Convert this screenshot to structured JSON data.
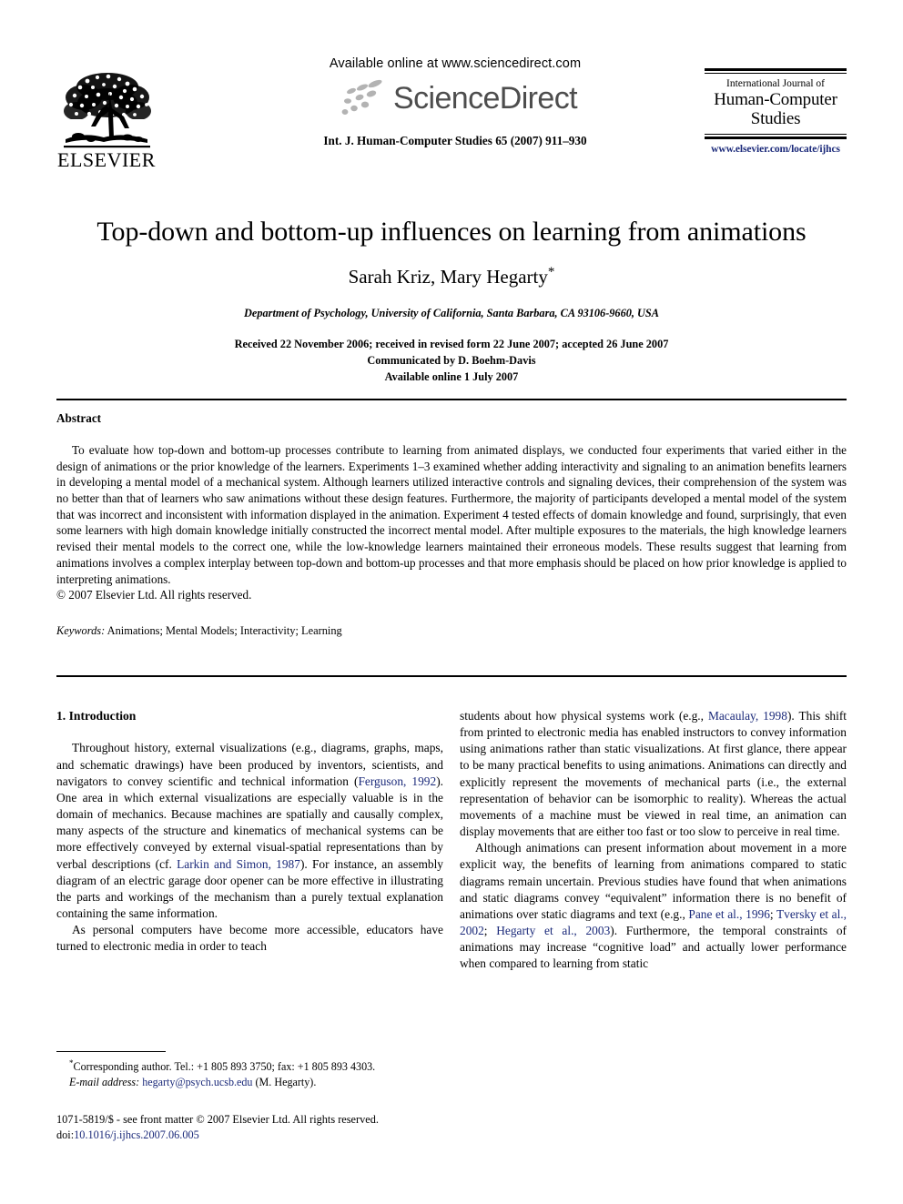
{
  "masthead": {
    "publisher_logo_label": "ELSEVIER",
    "sciencedirect": {
      "available_online": "Available online at www.sciencedirect.com",
      "wordmark": "ScienceDirect",
      "journal_reference": "Int. J. Human-Computer Studies 65 (2007) 911–930"
    },
    "journal_box": {
      "line1": "International Journal of",
      "line2": "Human-Computer",
      "line3": "Studies",
      "url": "www.elsevier.com/locate/ijhcs",
      "url_color": "#1b2a7a"
    }
  },
  "title_block": {
    "title": "Top-down and bottom-up influences on learning from animations",
    "authors": "Sarah Kriz, Mary Hegarty",
    "corresponding_marker": "*",
    "affiliation": "Department of Psychology, University of California, Santa Barbara, CA 93106-9660, USA",
    "history_line1": "Received 22 November 2006; received in revised form 22 June 2007; accepted 26 June 2007",
    "history_line2": "Communicated by D. Boehm-Davis",
    "history_line3": "Available online 1 July 2007"
  },
  "abstract": {
    "heading": "Abstract",
    "body": "To evaluate how top-down and bottom-up processes contribute to learning from animated displays, we conducted four experiments that varied either in the design of animations or the prior knowledge of the learners. Experiments 1–3 examined whether adding interactivity and signaling to an animation benefits learners in developing a mental model of a mechanical system. Although learners utilized interactive controls and signaling devices, their comprehension of the system was no better than that of learners who saw animations without these design features. Furthermore, the majority of participants developed a mental model of the system that was incorrect and inconsistent with information displayed in the animation. Experiment 4 tested effects of domain knowledge and found, surprisingly, that even some learners with high domain knowledge initially constructed the incorrect mental model. After multiple exposures to the materials, the high knowledge learners revised their mental models to the correct one, while the low-knowledge learners maintained their erroneous models. These results suggest that learning from animations involves a complex interplay between top-down and bottom-up processes and that more emphasis should be placed on how prior knowledge is applied to interpreting animations.",
    "copyright": "© 2007 Elsevier Ltd. All rights reserved.",
    "keywords_label": "Keywords:",
    "keywords_value": "Animations; Mental Models; Interactivity; Learning"
  },
  "body": {
    "section_heading": "1. Introduction",
    "left_col": {
      "p1_part1": "Throughout history, external visualizations (e.g., diagrams, graphs, maps, and schematic drawings) have been produced by inventors, scientists, and navigators to convey scientific and technical information (",
      "p1_cite1": "Ferguson, 1992",
      "p1_part2": "). One area in which external visualizations are especially valuable is in the domain of mechanics. Because machines are spatially and causally complex, many aspects of the structure and kinematics of mechanical systems can be more effectively conveyed by external visual-spatial representations than by verbal descriptions (cf. ",
      "p1_cite2": "Larkin and Simon, 1987",
      "p1_part3": "). For instance, an assembly diagram of an electric garage door opener can be more effective in illustrating the parts and workings of the mechanism than a purely textual explanation containing the same information.",
      "p2": "As personal computers have become more accessible, educators have turned to electronic media in order to teach"
    },
    "right_col": {
      "p2_cont_part1": "students about how physical systems work (e.g., ",
      "p2_cite1": "Macaulay, 1998",
      "p2_part2": "). This shift from printed to electronic media has enabled instructors to convey information using animations rather than static visualizations. At first glance, there appear to be many practical benefits to using animations. Animations can directly and explicitly represent the movements of mechanical parts (i.e., the external representation of behavior can be isomorphic to reality). Whereas the actual movements of a machine must be viewed in real time, an animation can display movements that are either too fast or too slow to perceive in real time.",
      "p3_part1": "Although animations can present information about movement in a more explicit way, the benefits of learning from animations compared to static diagrams remain uncertain. Previous studies have found that when animations and static diagrams convey “equivalent” information there is no benefit of animations over static diagrams and text (e.g., ",
      "p3_cite1": "Pane et al., 1996",
      "p3_sep1": "; ",
      "p3_cite2": "Tversky et al., 2002",
      "p3_sep2": "; ",
      "p3_cite3": "Hegarty et al., 2003",
      "p3_part2": "). Furthermore, the temporal constraints of animations may increase “cognitive load” and actually lower performance when compared to learning from static"
    }
  },
  "footnote": {
    "corresponding_marker": "*",
    "corresponding_text": "Corresponding author. Tel.: +1 805 893 3750; fax: +1 805 893 4303.",
    "email_label": "E-mail address:",
    "email_address": "hegarty@psych.ucsb.edu",
    "email_owner": "(M. Hegarty)."
  },
  "imprint": {
    "front_matter": "1071-5819/$ - see front matter © 2007 Elsevier Ltd. All rights reserved.",
    "doi_label": "doi:",
    "doi_value": "10.1016/j.ijhcs.2007.06.005"
  },
  "colors": {
    "link": "#1b2a7a",
    "text": "#000000",
    "sciencedirect_gray": "#4d4d4d",
    "background": "#ffffff"
  }
}
